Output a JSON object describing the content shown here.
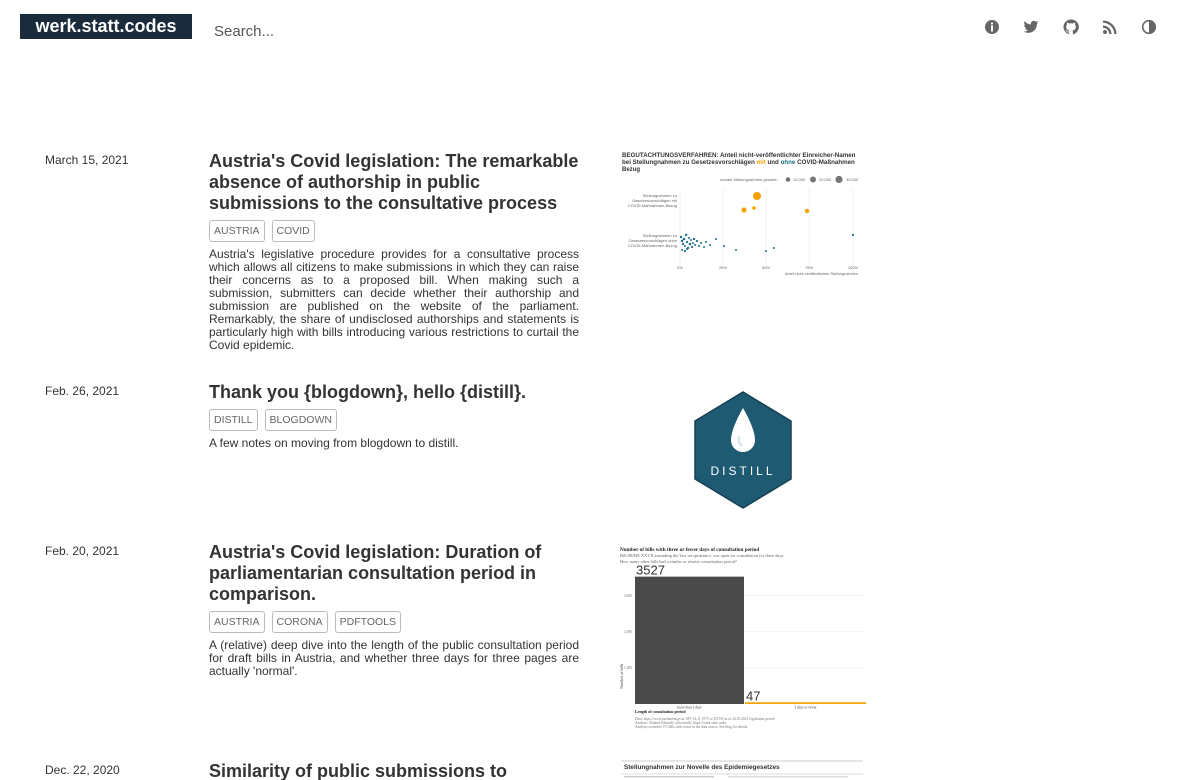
{
  "header": {
    "logo": "werk.statt.codes",
    "search_placeholder": "Search...",
    "icons": [
      "info-icon",
      "twitter-icon",
      "github-icon",
      "rss-icon",
      "theme-toggle-icon"
    ]
  },
  "posts": [
    {
      "date": "March 15, 2021",
      "title": "Austria's Covid legislation: The remarkable absence of authorship in public submissions to the consultative process",
      "tags": [
        "AUSTRIA",
        "COVID"
      ],
      "description": "Austria's legislative procedure provides for a consultative process which allows all citizens to make submissions in which they can raise their concerns as to a proposed bill. When making such a submission, submitters can decide whether their authorship and submission are published on the website of the parliament. Remarkably, the share of undisclosed authorships and statements is particularly high with bills introducing various restrictions to curtail the Covid epidemic.",
      "thumb": {
        "title": "BEGUTACHTUNGSVERFAHREN: Anteil nicht-veröffentlichter Einreicher-Namen",
        "subtitle_a": "bei Stellungnahmen zu Gesetzesvorschlägen",
        "subtitle_mit": "mit",
        "subtitle_und": "und",
        "subtitle_ohne": "ohne",
        "subtitle_b": "COVID-Maßnahmen",
        "subtitle_c": "Bezug",
        "size_legend": "Anzahl Stellungnahmen gesamt:",
        "size_levels": [
          "10,000",
          "20,000",
          "30,000"
        ],
        "label_mit": [
          "Stellungnahmen zu",
          "Gesetzesvorschlägen mit",
          "COVID-Maßnahmen-Bezug"
        ],
        "label_ohne": [
          "Stellungnahmen zu",
          "Gesetzesvorschlägen ohne",
          "COVID-Maßnahmen-Bezug"
        ],
        "xticks": [
          "0%",
          "25%",
          "50%",
          "75%",
          "100%"
        ],
        "xlabel": "Anteil nicht-veröffentlichter Stellungnahmen"
      }
    },
    {
      "date": "Feb. 26, 2021",
      "title": "Thank you {blogdown}, hello {distill}.",
      "tags": [
        "DISTILL",
        "BLOGDOWN"
      ],
      "description": "A few notes on moving from blogdown to distill.",
      "thumb": {
        "logo_text": "DISTILL"
      }
    },
    {
      "date": "Feb. 20, 2021",
      "title": "Austria's Covid legislation: Duration of parliamentarian consultation period in comparison.",
      "tags": [
        "AUSTRIA",
        "CORONA",
        "PDFTOOLS"
      ],
      "description": "A (relative) deep dive into the length of the public consultation period for draft bills in Austria, and whether three days for three pages are actually 'normal'.",
      "thumb": {
        "title": "Number of bills with three or fewer days of consultation period",
        "subtitle1": "Bill 88/ME XXVII amending the 'law on epidemics' was open for consultation for three days.",
        "subtitle2": "How many other bills had a similar or shorter consultation period?",
        "ylabel": "Number of bills",
        "xlabel": "Length of consultation period",
        "yticks": [
          "3,000",
          "2,000",
          "1,000"
        ],
        "footer1": "Data: https://www.parlament.gv.at; MV 14.11.1975 to XXVII as of 24.01.2021 legislation period",
        "footer2": "Analysis: Roland Schmidt | @zoowalk | https://werk.statt.codes",
        "footer3": "Analysis excluded 171 bills with errors in the data source. See blog for details."
      }
    },
    {
      "date": "Dec. 22, 2020",
      "title": "Similarity of public submissions to",
      "tags": [],
      "description": "",
      "thumb": {
        "title": "Stellungnahmen zur Novelle des Epidemiegesetzes"
      }
    }
  ],
  "chart_data": {
    "type": "bar",
    "title": "Number of bills with three or fewer days of consultation period",
    "categories": [
      "more than 3 days",
      "3 days or fewer"
    ],
    "values": [
      3527,
      47
    ],
    "xlabel": "Length of consultation period",
    "ylabel": "Number of bills",
    "ylim": [
      0,
      3600
    ],
    "colors": [
      "#4a4a4a",
      "#f5a300"
    ]
  },
  "colors": {
    "logo_bg": "#1a2b3c",
    "accent_orange": "#f5a300",
    "accent_teal": "#1d6e8a",
    "distill_hex": "#1e5a72"
  }
}
